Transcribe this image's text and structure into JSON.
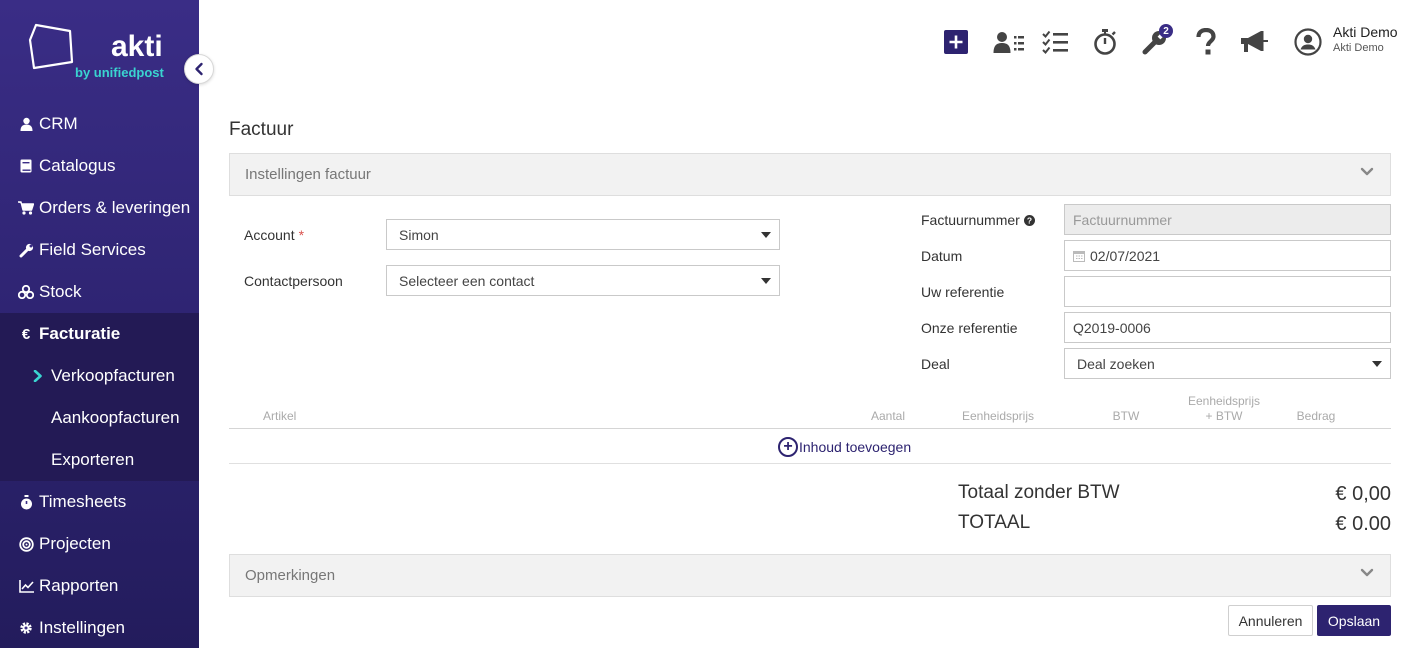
{
  "brand": {
    "name": "akti",
    "byline": "by unifiedpost"
  },
  "sidebar": {
    "items": [
      {
        "label": "CRM",
        "icon": "user-icon"
      },
      {
        "label": "Catalogus",
        "icon": "book-icon"
      },
      {
        "label": "Orders & leveringen",
        "icon": "cart-icon"
      },
      {
        "label": "Field Services",
        "icon": "wrench-icon"
      },
      {
        "label": "Stock",
        "icon": "boxes-icon"
      },
      {
        "label": "Facturatie",
        "icon": "euro-icon"
      },
      {
        "label": "Verkoopfacturen"
      },
      {
        "label": "Aankoopfacturen"
      },
      {
        "label": "Exporteren"
      },
      {
        "label": "Timesheets",
        "icon": "stopwatch-icon"
      },
      {
        "label": "Projecten",
        "icon": "target-icon"
      },
      {
        "label": "Rapporten",
        "icon": "chart-icon"
      },
      {
        "label": "Instellingen",
        "icon": "gear-icon"
      }
    ]
  },
  "topbar": {
    "tools_badge": "2",
    "user": {
      "name": "Akti Demo",
      "company": "Akti Demo"
    }
  },
  "page": {
    "title": "Factuur",
    "settings_panel": "Instellingen factuur",
    "account_label": "Account",
    "account_required": "*",
    "account_value": "Simon",
    "contact_label": "Contactpersoon",
    "contact_value": "Selecteer een contact",
    "invoice_number_label": "Factuurnummer",
    "invoice_number_placeholder": "Factuurnummer",
    "date_label": "Datum",
    "date_value": "02/07/2021",
    "your_ref_label": "Uw referentie",
    "your_ref_value": "",
    "our_ref_label": "Onze referentie",
    "our_ref_value": "Q2019-0006",
    "deal_label": "Deal",
    "deal_value": "Deal zoeken"
  },
  "table": {
    "col_article": "Artikel",
    "col_qty": "Aantal",
    "col_unit_price": "Eenheidsprijs",
    "col_vat": "BTW",
    "col_unit_price_vat_1": "Eenheidsprijs",
    "col_unit_price_vat_2": "+ BTW",
    "col_amount": "Bedrag",
    "add_content": "Inhoud toevoegen"
  },
  "totals": {
    "excl_label": "Totaal zonder BTW",
    "excl_value": "€ 0,00",
    "total_label": "TOTAAL",
    "total_value": "€ 0.00"
  },
  "remarks_panel": "Opmerkingen",
  "actions": {
    "cancel": "Annuleren",
    "save": "Opslaan"
  },
  "colors": {
    "sidebar": "#2d2370",
    "accent": "#3ad4d0",
    "primary_button": "#2d2370"
  }
}
